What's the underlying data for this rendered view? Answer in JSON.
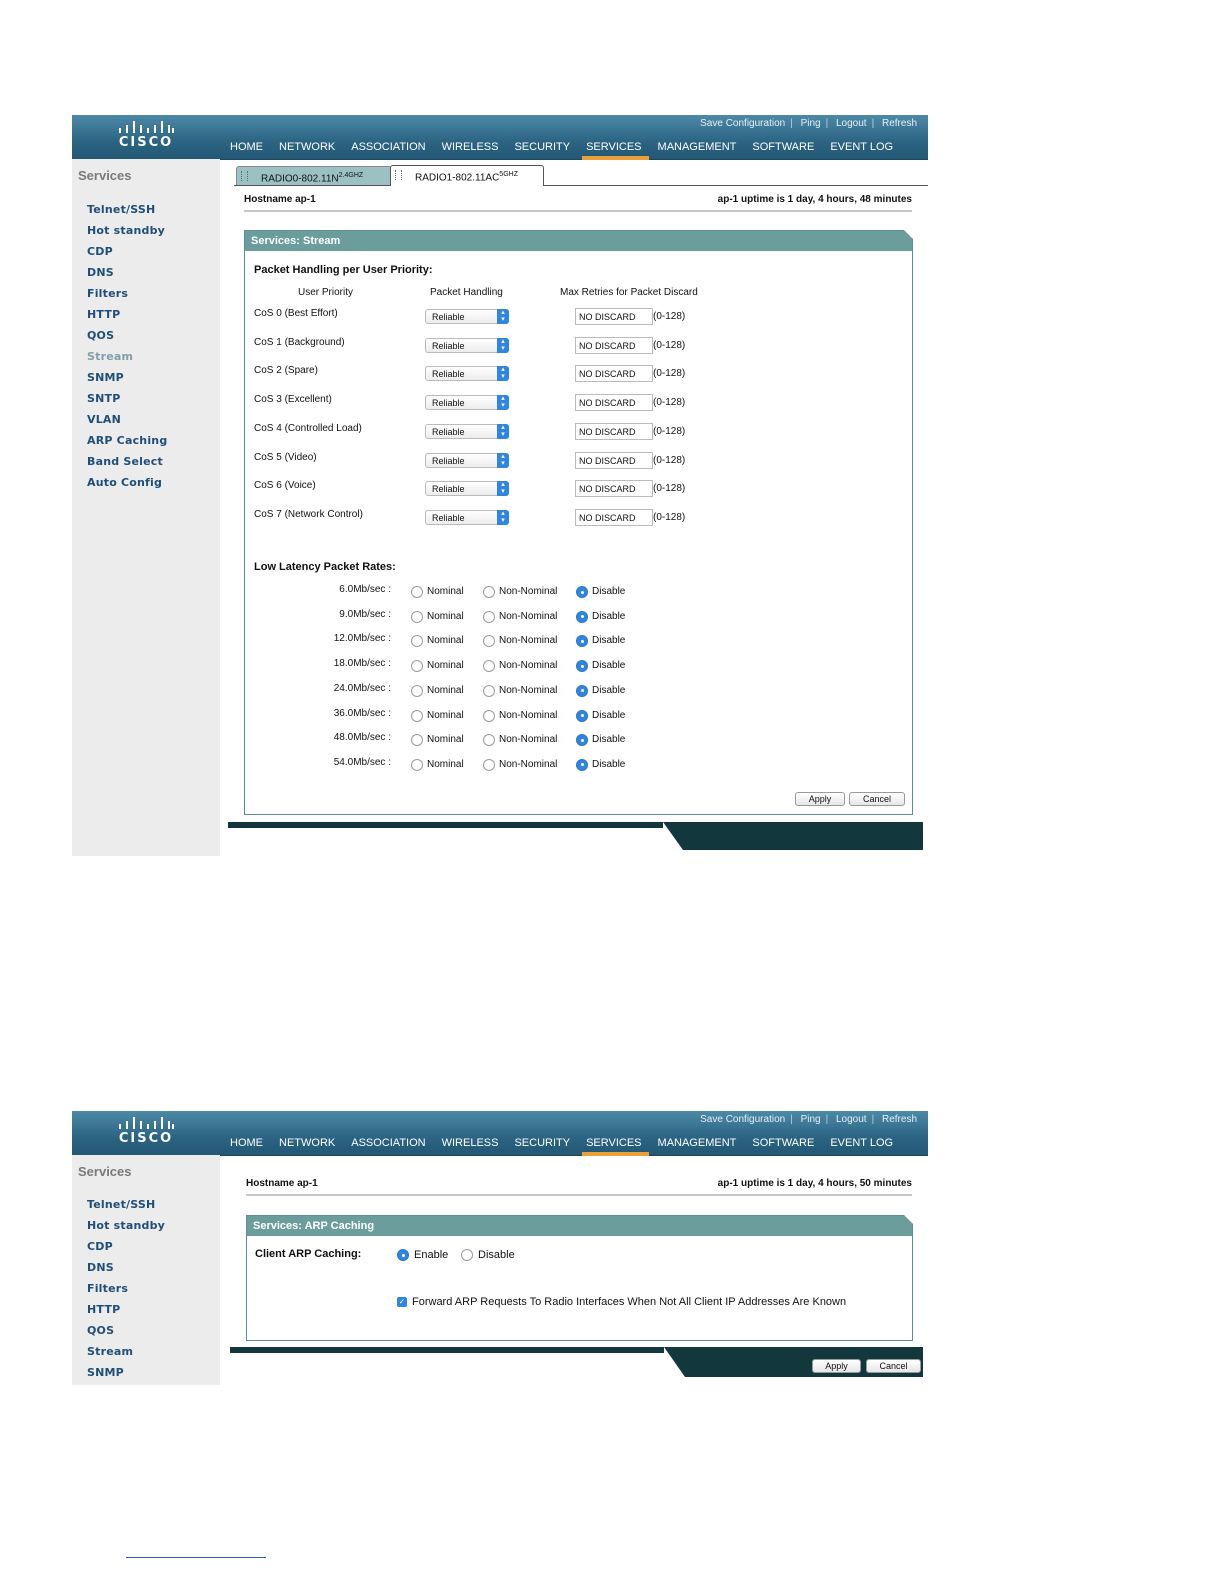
{
  "header": {
    "logo_text": "CISCO",
    "utility_links": [
      "Save Configuration",
      "Ping",
      "Logout",
      "Refresh"
    ],
    "nav": [
      "HOME",
      "NETWORK",
      "ASSOCIATION",
      "WIRELESS",
      "SECURITY",
      "SERVICES",
      "MANAGEMENT",
      "SOFTWARE",
      "EVENT LOG"
    ],
    "active_nav": "SERVICES"
  },
  "shot1": {
    "sidebar_title": "Services",
    "sidebar_items": [
      "Telnet/SSH",
      "Hot standby",
      "CDP",
      "DNS",
      "Filters",
      "HTTP",
      "QOS",
      "Stream",
      "SNMP",
      "SNTP",
      "VLAN",
      "ARP Caching",
      "Band Select",
      "Auto Config"
    ],
    "current_item": "Stream",
    "tabs": [
      {
        "label": "RADIO0-802.11N",
        "sup": "2.4GHZ"
      },
      {
        "label": "RADIO1-802.11AC",
        "sup": "5GHZ"
      }
    ],
    "hostname": "Hostname  ap-1",
    "uptime": "ap-1 uptime is 1 day, 4 hours, 48 minutes",
    "panel_title": "Services: Stream",
    "packet_section": "Packet Handling per User Priority:",
    "col_user_priority": "User Priority",
    "col_packet_handling": "Packet Handling",
    "col_max_retries": "Max Retries for Packet Discard",
    "cos_rows": [
      {
        "name": "CoS 0 (Best Effort)",
        "handling": "Reliable",
        "retries": "NO DISCARD",
        "range": "(0-128)"
      },
      {
        "name": "CoS 1 (Background)",
        "handling": "Reliable",
        "retries": "NO DISCARD",
        "range": "(0-128)"
      },
      {
        "name": "CoS 2 (Spare)",
        "handling": "Reliable",
        "retries": "NO DISCARD",
        "range": "(0-128)"
      },
      {
        "name": "CoS 3 (Excellent)",
        "handling": "Reliable",
        "retries": "NO DISCARD",
        "range": "(0-128)"
      },
      {
        "name": "CoS 4 (Controlled Load)",
        "handling": "Reliable",
        "retries": "NO DISCARD",
        "range": "(0-128)"
      },
      {
        "name": "CoS 5 (Video)",
        "handling": "Reliable",
        "retries": "NO DISCARD",
        "range": "(0-128)"
      },
      {
        "name": "CoS 6 (Voice)",
        "handling": "Reliable",
        "retries": "NO DISCARD",
        "range": "(0-128)"
      },
      {
        "name": "CoS 7 (Network Control)",
        "handling": "Reliable",
        "retries": "NO DISCARD",
        "range": "(0-128)"
      }
    ],
    "latency_section": "Low Latency Packet Rates:",
    "rate_options": [
      "Nominal",
      "Non-Nominal",
      "Disable"
    ],
    "rates": [
      {
        "rate": "6.0Mb/sec :",
        "selected": "Disable"
      },
      {
        "rate": "9.0Mb/sec :",
        "selected": "Disable"
      },
      {
        "rate": "12.0Mb/sec :",
        "selected": "Disable"
      },
      {
        "rate": "18.0Mb/sec :",
        "selected": "Disable"
      },
      {
        "rate": "24.0Mb/sec :",
        "selected": "Disable"
      },
      {
        "rate": "36.0Mb/sec :",
        "selected": "Disable"
      },
      {
        "rate": "48.0Mb/sec :",
        "selected": "Disable"
      },
      {
        "rate": "54.0Mb/sec :",
        "selected": "Disable"
      }
    ],
    "apply_label": "Apply",
    "cancel_label": "Cancel"
  },
  "shot2": {
    "sidebar_title": "Services",
    "sidebar_items": [
      "Telnet/SSH",
      "Hot standby",
      "CDP",
      "DNS",
      "Filters",
      "HTTP",
      "QOS",
      "Stream",
      "SNMP"
    ],
    "hostname": "Hostname  ap-1",
    "uptime": "ap-1 uptime is 1 day, 4 hours, 50 minutes",
    "panel_title": "Services: ARP Caching",
    "client_arp_label": "Client ARP Caching:",
    "enable_label": "Enable",
    "disable_label": "Disable",
    "selected": "Enable",
    "forward_label": "Forward ARP Requests To Radio Interfaces When Not All Client IP Addresses Are Known",
    "forward_checked": true,
    "apply_label": "Apply",
    "cancel_label": "Cancel"
  },
  "colors": {
    "header": "#2c6484",
    "panel_title": "#6a9d9b",
    "active_nav_underline": "#e9a03a",
    "radio_selected": "#2f86e0",
    "footer": "#12383e"
  }
}
